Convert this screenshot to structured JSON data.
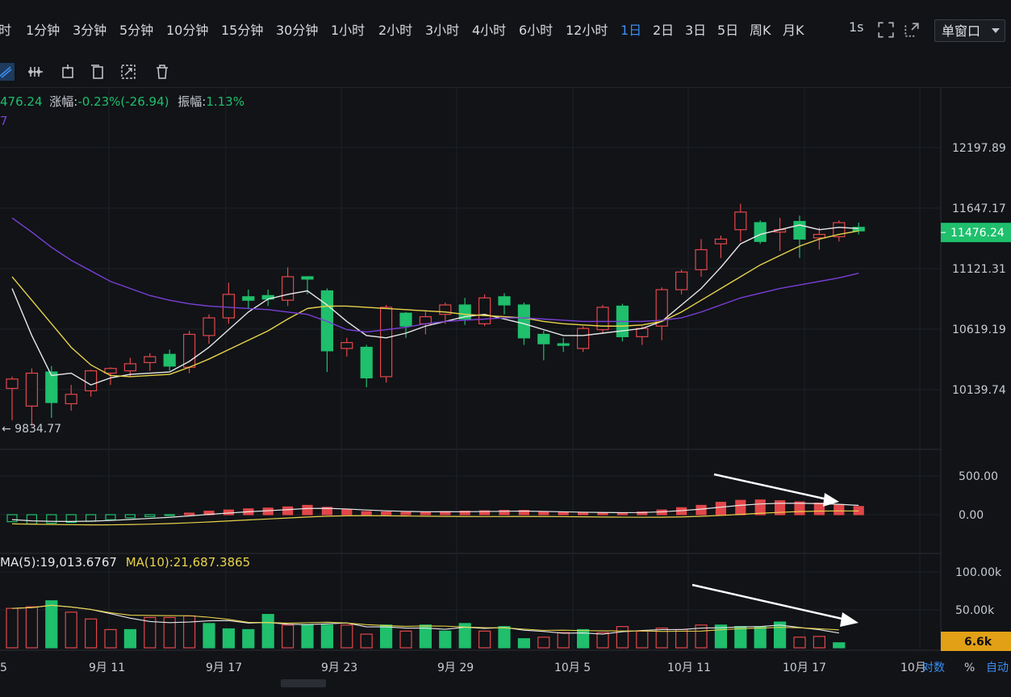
{
  "timeframes": [
    "时",
    "1分钟",
    "3分钟",
    "5分钟",
    "10分钟",
    "15分钟",
    "30分钟",
    "1小时",
    "2小时",
    "3小时",
    "4小时",
    "6小时",
    "12小时",
    "1日",
    "2日",
    "3日",
    "5日",
    "周K",
    "月K"
  ],
  "active_timeframe": "1日",
  "interval_label": "1s",
  "window_select": "单窗口",
  "info": {
    "price_fragment": "476.24",
    "change_label": "涨幅:",
    "change_value": "-0.23%(-26.94)",
    "amplitude_label": "振幅:",
    "amplitude_value": "1.13%",
    "ma_fragment": "7"
  },
  "price_axis": [
    "12197.89",
    "11647.17",
    "11121.31",
    "10619.19",
    "10139.74"
  ],
  "current_price": "11476.24",
  "low_marker": "9834.77",
  "macd_axis": [
    "500.00",
    "0.00"
  ],
  "volume_legend": {
    "ma5": "MA(5):19,013.6767",
    "ma10": "MA(10):21,687.3865"
  },
  "volume_axis": [
    "100.00k",
    "50.00k"
  ],
  "current_volume": "6.6k",
  "x_axis_labels": [
    "5",
    "9月 11",
    "9月 17",
    "9月 23",
    "9月 29",
    "10月 5",
    "10月 11",
    "10月 17",
    "10月"
  ],
  "bottom_right": {
    "log": "对数",
    "percent": "%",
    "auto": "自动"
  },
  "colors": {
    "up": "#e2474a",
    "down": "#1fbf6c",
    "ma_white": "#e8e8e8",
    "ma_yellow": "#e8d34a",
    "ma_purple": "#7a3fd6",
    "accent": "#3b8df0",
    "volume_badge": "#e2a017"
  },
  "chart_data": {
    "type": "candlestick",
    "title": "",
    "dates": [
      "9/5",
      "9/6",
      "9/7",
      "9/8",
      "9/9",
      "9/10",
      "9/11",
      "9/12",
      "9/13",
      "9/14",
      "9/15",
      "9/16",
      "9/17",
      "9/18",
      "9/19",
      "9/20",
      "9/21",
      "9/22",
      "9/23",
      "9/24",
      "9/25",
      "9/26",
      "9/27",
      "9/28",
      "9/29",
      "9/30",
      "10/1",
      "10/2",
      "10/3",
      "10/4",
      "10/5",
      "10/6",
      "10/7",
      "10/8",
      "10/9",
      "10/10",
      "10/11",
      "10/12",
      "10/13",
      "10/14",
      "10/15",
      "10/16",
      "10/17",
      "10/18"
    ],
    "ohlc": [
      [
        10150,
        10230,
        9880,
        10250
      ],
      [
        10000,
        10280,
        9830,
        10320
      ],
      [
        10290,
        10030,
        9900,
        10340
      ],
      [
        10020,
        10100,
        9960,
        10180
      ],
      [
        10130,
        10300,
        10080,
        10310
      ],
      [
        10280,
        10320,
        10180,
        10330
      ],
      [
        10300,
        10360,
        10250,
        10410
      ],
      [
        10370,
        10420,
        10300,
        10450
      ],
      [
        10440,
        10340,
        10300,
        10480
      ],
      [
        10330,
        10610,
        10280,
        10640
      ],
      [
        10600,
        10750,
        10530,
        10780
      ],
      [
        10750,
        10950,
        10700,
        11050
      ],
      [
        10930,
        10900,
        10830,
        10990
      ],
      [
        10940,
        10910,
        10850,
        10990
      ],
      [
        10900,
        11100,
        10850,
        11180
      ],
      [
        11100,
        11080,
        10950,
        11100
      ],
      [
        10980,
        10470,
        10290,
        11000
      ],
      [
        10490,
        10540,
        10420,
        10580
      ],
      [
        10500,
        10240,
        10160,
        10520
      ],
      [
        10250,
        10840,
        10200,
        10860
      ],
      [
        10790,
        10680,
        10580,
        10800
      ],
      [
        10700,
        10760,
        10610,
        10810
      ],
      [
        10780,
        10860,
        10700,
        10880
      ],
      [
        10860,
        10740,
        10690,
        10920
      ],
      [
        10700,
        10920,
        10680,
        10950
      ],
      [
        10930,
        10860,
        10780,
        10960
      ],
      [
        10860,
        10580,
        10520,
        10880
      ],
      [
        10610,
        10530,
        10390,
        10640
      ],
      [
        10530,
        10520,
        10460,
        10580
      ],
      [
        10490,
        10660,
        10460,
        10680
      ],
      [
        10650,
        10840,
        10620,
        10860
      ],
      [
        10850,
        10590,
        10550,
        10870
      ],
      [
        10590,
        10660,
        10520,
        10680
      ],
      [
        10680,
        10990,
        10560,
        11010
      ],
      [
        10990,
        11140,
        10950,
        11160
      ],
      [
        11160,
        11330,
        11100,
        11420
      ],
      [
        11380,
        11420,
        11260,
        11450
      ],
      [
        11500,
        11650,
        11400,
        11720
      ],
      [
        11560,
        11400,
        11380,
        11580
      ],
      [
        11480,
        11500,
        11320,
        11600
      ],
      [
        11570,
        11420,
        11260,
        11620
      ],
      [
        11430,
        11460,
        11330,
        11520
      ],
      [
        11440,
        11560,
        11400,
        11580
      ],
      [
        11520,
        11490,
        11460,
        11560
      ]
    ],
    "ma_lines": [
      {
        "name": "MA white",
        "values": [
          11000,
          10600,
          10260,
          10280,
          10180,
          10240,
          10270,
          10280,
          10290,
          10380,
          10500,
          10650,
          10800,
          10910,
          10950,
          10980,
          10860,
          10720,
          10600,
          10580,
          10620,
          10680,
          10720,
          10760,
          10780,
          10740,
          10700,
          10650,
          10600,
          10600,
          10620,
          10640,
          10660,
          10720,
          10860,
          11000,
          11180,
          11380,
          11460,
          11500,
          11540,
          11500,
          11520,
          11510
        ]
      },
      {
        "name": "MA yellow",
        "values": [
          11100,
          10900,
          10700,
          10500,
          10350,
          10260,
          10250,
          10260,
          10270,
          10330,
          10400,
          10480,
          10560,
          10640,
          10740,
          10830,
          10850,
          10850,
          10840,
          10830,
          10820,
          10810,
          10800,
          10780,
          10770,
          10760,
          10750,
          10720,
          10700,
          10690,
          10680,
          10680,
          10690,
          10720,
          10800,
          10900,
          11000,
          11100,
          11200,
          11280,
          11360,
          11420,
          11460,
          11490
        ]
      },
      {
        "name": "MA purple",
        "values": [
          11600,
          11480,
          11350,
          11240,
          11150,
          11060,
          11000,
          10940,
          10900,
          10870,
          10850,
          10840,
          10830,
          10820,
          10800,
          10780,
          10720,
          10650,
          10630,
          10650,
          10670,
          10700,
          10720,
          10730,
          10740,
          10750,
          10750,
          10740,
          10730,
          10720,
          10720,
          10720,
          10720,
          10730,
          10750,
          10800,
          10860,
          10920,
          10960,
          11000,
          11030,
          11060,
          11090,
          11130
        ]
      }
    ],
    "macd": [
      -90,
      -120,
      -110,
      -100,
      -85,
      -65,
      -40,
      -25,
      -10,
      20,
      45,
      60,
      75,
      85,
      100,
      120,
      95,
      65,
      40,
      35,
      30,
      35,
      40,
      45,
      50,
      55,
      55,
      40,
      30,
      25,
      25,
      25,
      35,
      60,
      90,
      120,
      160,
      185,
      190,
      180,
      165,
      150,
      130,
      105
    ],
    "volume": [
      [
        52000,
        "up"
      ],
      [
        54000,
        "up"
      ],
      [
        62000,
        "down"
      ],
      [
        47000,
        "up"
      ],
      [
        38000,
        "up"
      ],
      [
        24000,
        "up"
      ],
      [
        24000,
        "down"
      ],
      [
        40000,
        "up"
      ],
      [
        40000,
        "up"
      ],
      [
        42000,
        "up"
      ],
      [
        32000,
        "down"
      ],
      [
        25000,
        "down"
      ],
      [
        24000,
        "down"
      ],
      [
        44000,
        "down"
      ],
      [
        30000,
        "up"
      ],
      [
        30000,
        "down"
      ],
      [
        30000,
        "down"
      ],
      [
        30000,
        "up"
      ],
      [
        18000,
        "up"
      ],
      [
        30000,
        "down"
      ],
      [
        22000,
        "up"
      ],
      [
        30000,
        "down"
      ],
      [
        22000,
        "down"
      ],
      [
        32000,
        "down"
      ],
      [
        22000,
        "up"
      ],
      [
        28000,
        "down"
      ],
      [
        12000,
        "down"
      ],
      [
        14000,
        "up"
      ],
      [
        20000,
        "up"
      ],
      [
        24000,
        "down"
      ],
      [
        20000,
        "up"
      ],
      [
        28000,
        "up"
      ],
      [
        22000,
        "up"
      ],
      [
        26000,
        "up"
      ],
      [
        24000,
        "up"
      ],
      [
        30000,
        "up"
      ],
      [
        30000,
        "down"
      ],
      [
        28000,
        "down"
      ],
      [
        28000,
        "down"
      ],
      [
        34000,
        "down"
      ],
      [
        14000,
        "up"
      ],
      [
        15000,
        "up"
      ],
      [
        6600,
        "down"
      ]
    ]
  }
}
